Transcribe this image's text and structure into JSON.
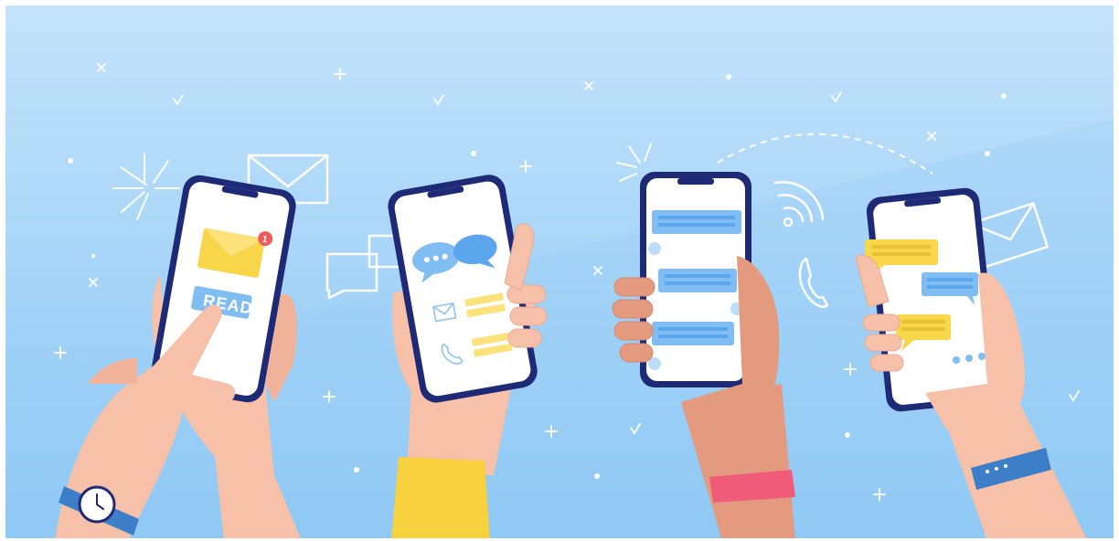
{
  "illustration": {
    "read_button_label": "READ",
    "notification_count": "1"
  },
  "colors": {
    "sky_top": "#bfe1fb",
    "sky_bottom": "#8cc8f5",
    "phone_frame": "#1f2a77",
    "screen": "#ffffff",
    "envelope": "#f9d54a",
    "badge": "#f15a5a",
    "chat_blue": "#7fbdf2",
    "chat_yellow": "#f8d84a",
    "skin_light": "#f6c1a8",
    "skin_dark": "#e39a7f",
    "sleeve": "#f7d13e",
    "band_pink": "#ef5b78",
    "band_blue": "#3c7ec8"
  }
}
